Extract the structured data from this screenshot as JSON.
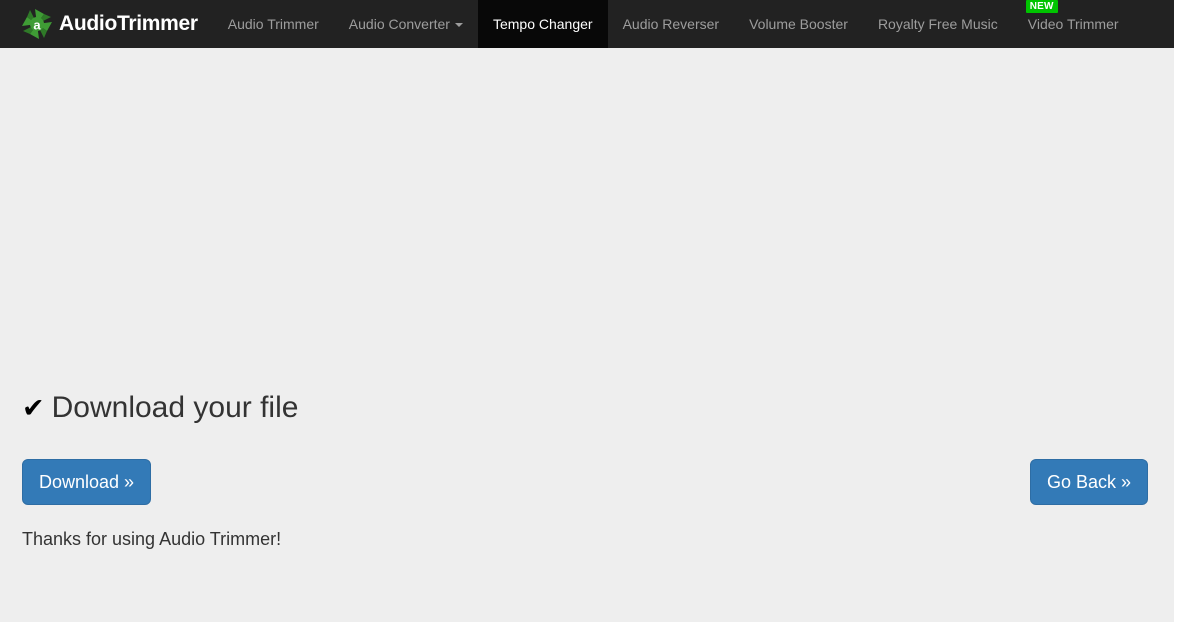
{
  "brand": {
    "name": "AudioTrimmer",
    "logo_icon": "pinwheel-logo-icon",
    "logo_letter": "a"
  },
  "nav": {
    "items": [
      {
        "label": "Audio Trimmer",
        "active": false,
        "has_caret": false,
        "badge": null
      },
      {
        "label": "Audio Converter",
        "active": false,
        "has_caret": true,
        "badge": null
      },
      {
        "label": "Tempo Changer",
        "active": true,
        "has_caret": false,
        "badge": null
      },
      {
        "label": "Audio Reverser",
        "active": false,
        "has_caret": false,
        "badge": null
      },
      {
        "label": "Volume Booster",
        "active": false,
        "has_caret": false,
        "badge": null
      },
      {
        "label": "Royalty Free Music",
        "active": false,
        "has_caret": false,
        "badge": null
      },
      {
        "label": "Video Trimmer",
        "active": false,
        "has_caret": false,
        "badge": "NEW"
      }
    ]
  },
  "main": {
    "heading": "Download your file",
    "heading_icon": "checkmark-icon",
    "heading_check_glyph": "✔",
    "download_button": "Download »",
    "goback_button": "Go Back »",
    "thanks": "Thanks for using Audio Trimmer!"
  },
  "colors": {
    "navbar_bg": "#222222",
    "nav_active_bg": "#080808",
    "nav_link": "#9d9d9d",
    "page_bg": "#eeeeee",
    "primary_button": "#337ab7",
    "primary_button_border": "#2e6da4",
    "badge_green": "#00c400",
    "logo_green": "#3f9c35",
    "text": "#333333"
  }
}
